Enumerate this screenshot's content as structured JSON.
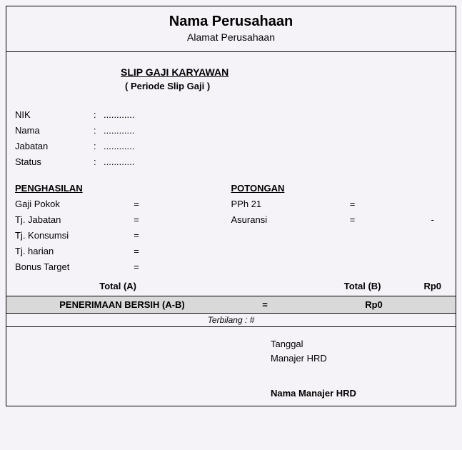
{
  "header": {
    "company_name": "Nama Perusahaan",
    "company_address": "Alamat Perusahaan"
  },
  "title": {
    "main": "SLIP GAJI KARYAWAN",
    "period": "( Periode Slip Gaji )"
  },
  "info": {
    "nik_label": "NIK",
    "nik_value": "............",
    "nama_label": "Nama",
    "nama_value": "............",
    "jabatan_label": "Jabatan",
    "jabatan_value": "............",
    "status_label": "Status",
    "status_value": "............",
    "colon": ":"
  },
  "penghasilan": {
    "title": "PENGHASILAN",
    "items": [
      {
        "label": "Gaji Pokok",
        "value": ""
      },
      {
        "label": "Tj. Jabatan",
        "value": ""
      },
      {
        "label": "Tj. Konsumsi",
        "value": ""
      },
      {
        "label": "Tj. harian",
        "value": ""
      },
      {
        "label": "Bonus Target",
        "value": ""
      }
    ],
    "total_label": "Total (A)",
    "total_value": ""
  },
  "potongan": {
    "title": "POTONGAN",
    "items": [
      {
        "label": "PPh 21",
        "value": ""
      },
      {
        "label": "Asuransi",
        "value": "-"
      }
    ],
    "total_label": "Total (B)",
    "total_value": "Rp0"
  },
  "eq": "=",
  "net": {
    "label": "PENERIMAAN BERSIH (A-B)",
    "eq": "=",
    "value": "Rp0"
  },
  "terbilang": {
    "prefix": "Terbilang :",
    "text": "#"
  },
  "footer": {
    "date_label": "Tanggal",
    "role_label": "Manajer HRD",
    "signer_name": "Nama Manajer HRD"
  }
}
